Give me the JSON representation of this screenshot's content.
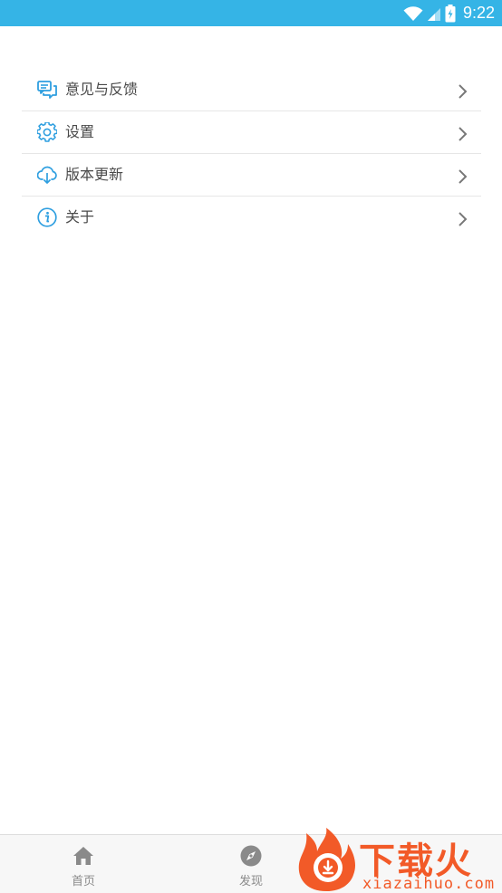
{
  "status_bar": {
    "time": "9:22",
    "icons": [
      "wifi-icon",
      "signal-icon",
      "battery-charging-icon"
    ],
    "color": "#35b4e6"
  },
  "menu": {
    "items": [
      {
        "label": "意见与反馈",
        "icon": "feedback-icon"
      },
      {
        "label": "设置",
        "icon": "gear-icon"
      },
      {
        "label": "版本更新",
        "icon": "cloud-download-icon"
      },
      {
        "label": "关于",
        "icon": "info-icon"
      }
    ],
    "accent_color": "#2f9fe0"
  },
  "bottom_nav": {
    "items": [
      {
        "label": "首页",
        "icon": "home-icon"
      },
      {
        "label": "发现",
        "icon": "compass-icon"
      }
    ]
  },
  "watermark": {
    "title": "下载火",
    "subtitle": "xiazaihuo.com",
    "color": "#f25a28"
  }
}
